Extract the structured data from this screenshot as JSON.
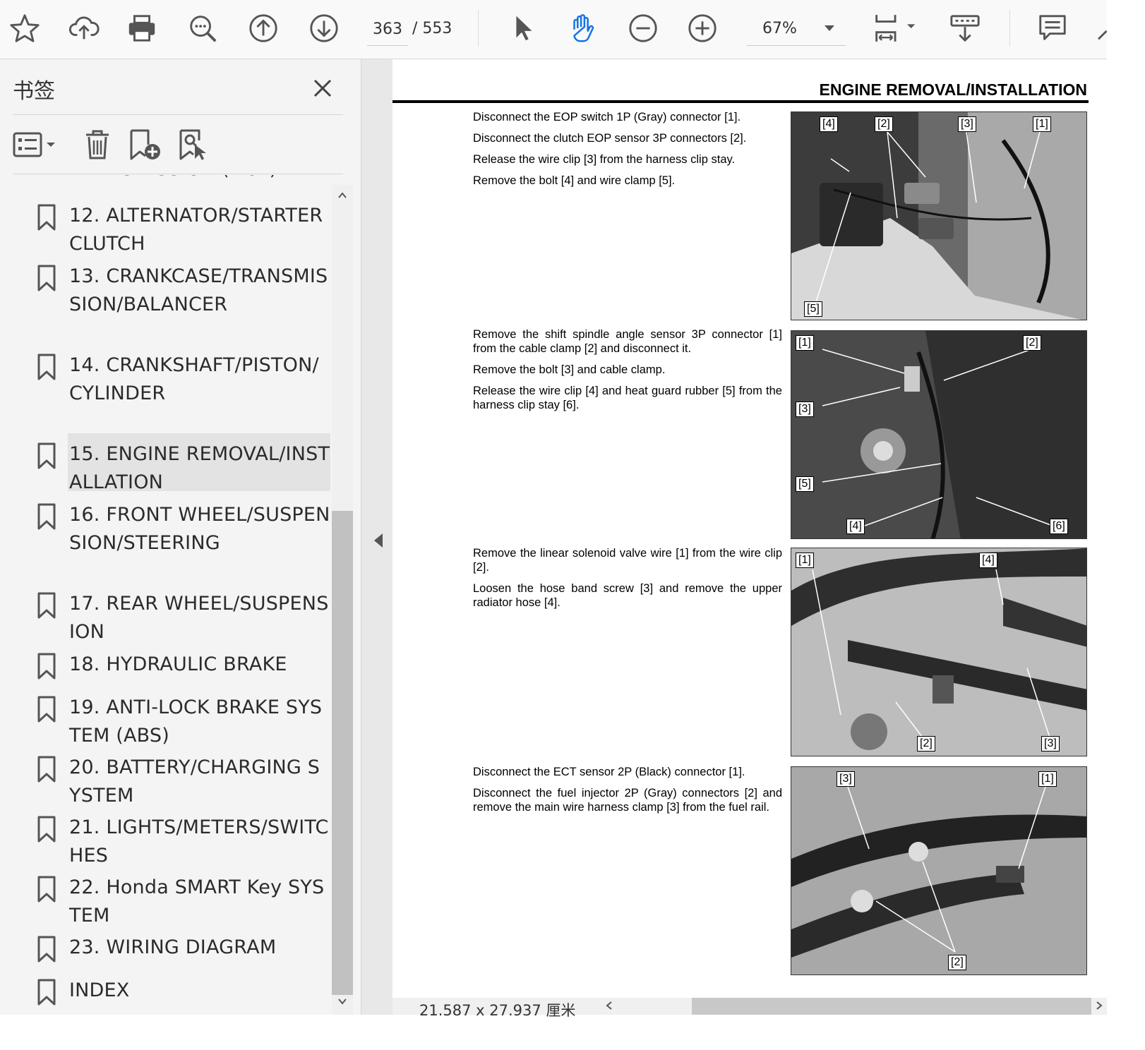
{
  "toolbar": {
    "page_current": "363",
    "page_total": "/ 553",
    "zoom": "67%",
    "icons": [
      "star-icon",
      "cloud-upload-icon",
      "print-icon",
      "zoom-search-icon",
      "page-up-icon",
      "page-down-icon",
      "select-pointer-icon",
      "hand-tool-icon",
      "zoom-out-icon",
      "zoom-in-icon",
      "fit-page-icon",
      "scroll-mode-icon",
      "comment-icon"
    ],
    "accent": "#1473e6"
  },
  "panel": {
    "title": "书签",
    "bookmarks": [
      {
        "label": "TRANSMISSION (DCT)",
        "cut": true
      },
      {
        "label": "12. ALTERNATOR/STARTER CLUTCH"
      },
      {
        "label": "13. CRANKCASE/TRANSMISSION/BALANCER"
      },
      {
        "label": "14. CRANKSHAFT/PISTON/CYLINDER"
      },
      {
        "label": "15. ENGINE REMOVAL/INSTALLATION",
        "selected": true
      },
      {
        "label": "16. FRONT WHEEL/SUSPENSION/STEERING"
      },
      {
        "label": "17. REAR WHEEL/SUSPENSION"
      },
      {
        "label": "18. HYDRAULIC BRAKE"
      },
      {
        "label": "19. ANTI-LOCK BRAKE SYSTEM (ABS)"
      },
      {
        "label": "20. BATTERY/CHARGING SYSTEM"
      },
      {
        "label": "21. LIGHTS/METERS/SWITCHES"
      },
      {
        "label": "22. Honda SMART Key SYSTEM"
      },
      {
        "label": "23. WIRING DIAGRAM"
      },
      {
        "label": "INDEX"
      }
    ]
  },
  "document": {
    "header": "ENGINE REMOVAL/INSTALLATION",
    "steps": [
      {
        "paragraphs": [
          "Disconnect the EOP switch 1P (Gray) connector [1].",
          "Disconnect the clutch EOP sensor 3P connectors [2].",
          "Release the wire clip [3] from the harness clip stay.",
          "Remove the bolt [4] and wire clamp [5]."
        ],
        "callouts": [
          "[4]",
          "[2]",
          "[3]",
          "[1]",
          "[5]"
        ]
      },
      {
        "paragraphs": [
          "Remove the shift spindle angle sensor 3P connector [1] from the cable clamp [2] and disconnect it.",
          "Remove the bolt [3] and cable clamp.",
          "Release the wire clip [4] and heat guard rubber [5] from the harness clip stay [6]."
        ],
        "callouts": [
          "[1]",
          "[2]",
          "[3]",
          "[5]",
          "[4]",
          "[6]"
        ]
      },
      {
        "paragraphs": [
          "Remove the linear solenoid valve wire [1] from the wire clip [2].",
          "Loosen the hose band screw [3] and remove the upper radiator hose [4]."
        ],
        "callouts": [
          "[1]",
          "[4]",
          "[2]",
          "[3]"
        ]
      },
      {
        "paragraphs": [
          "Disconnect the ECT sensor 2P (Black) connector [1].",
          "Disconnect the fuel injector 2P (Gray) connectors [2] and remove the main wire harness clamp [3] from the fuel rail."
        ],
        "callouts": [
          "[3]",
          "[1]",
          "[2]"
        ]
      }
    ]
  },
  "status": {
    "dimensions": "21.587 x 27.937 厘米"
  }
}
